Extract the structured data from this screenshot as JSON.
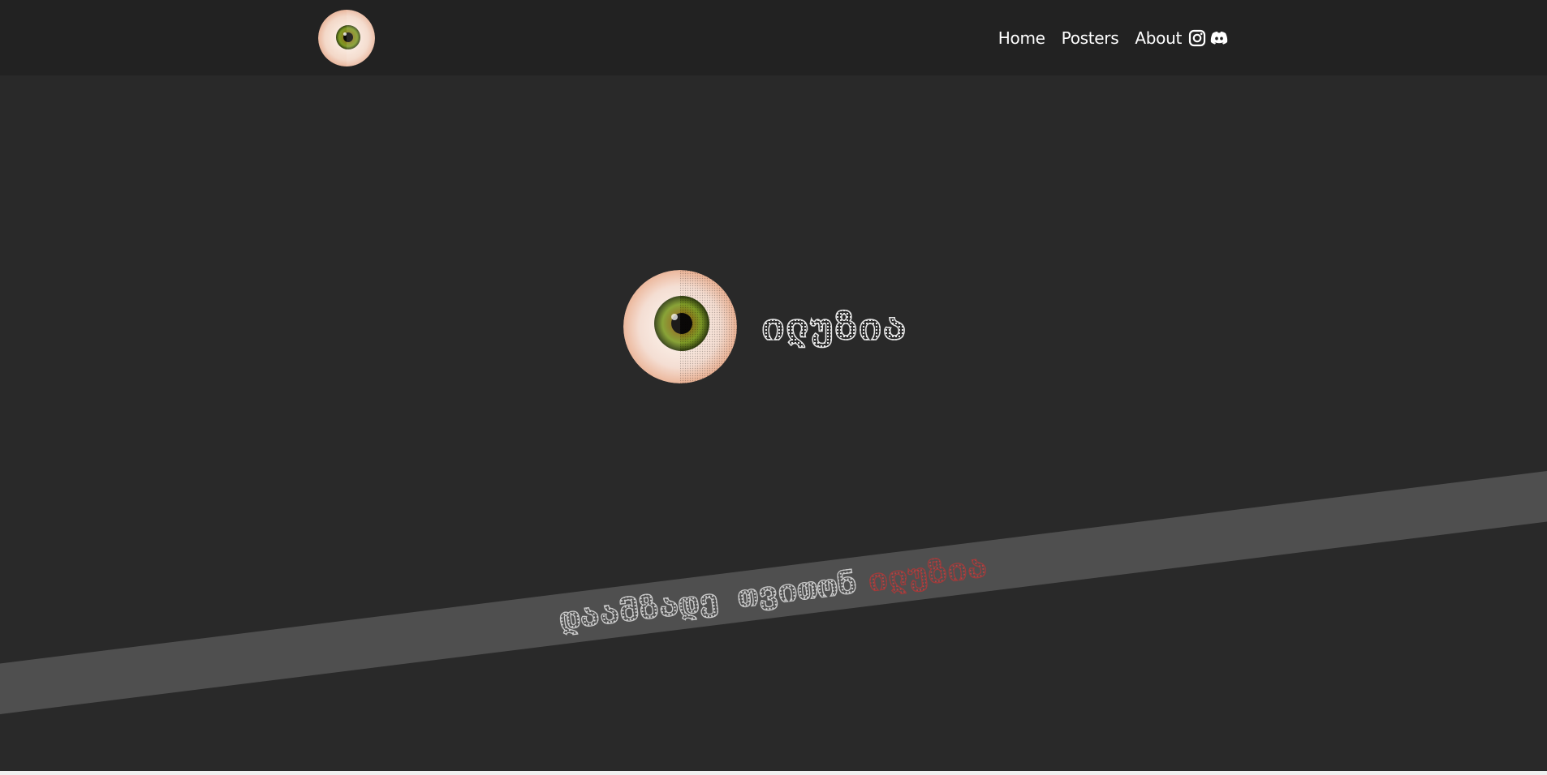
{
  "header": {
    "logo_icon": "eye-icon",
    "nav": [
      {
        "label": "Home"
      },
      {
        "label": "Posters"
      },
      {
        "label": "About"
      }
    ],
    "social": [
      {
        "icon": "instagram-icon"
      },
      {
        "icon": "discord-icon"
      }
    ]
  },
  "hero": {
    "logo_icon": "eye-icon",
    "title": "ილუზია"
  },
  "ribbon": {
    "text_a": "დაამზადე თვითონ",
    "text_b": "ილუზია",
    "color_a": "#c9c9c9",
    "color_b": "#a13a3a"
  },
  "colors": {
    "background": "#292929",
    "navbar": "#222222",
    "ribbon": "#4f4f4f",
    "accent_red": "#a13a3a"
  }
}
